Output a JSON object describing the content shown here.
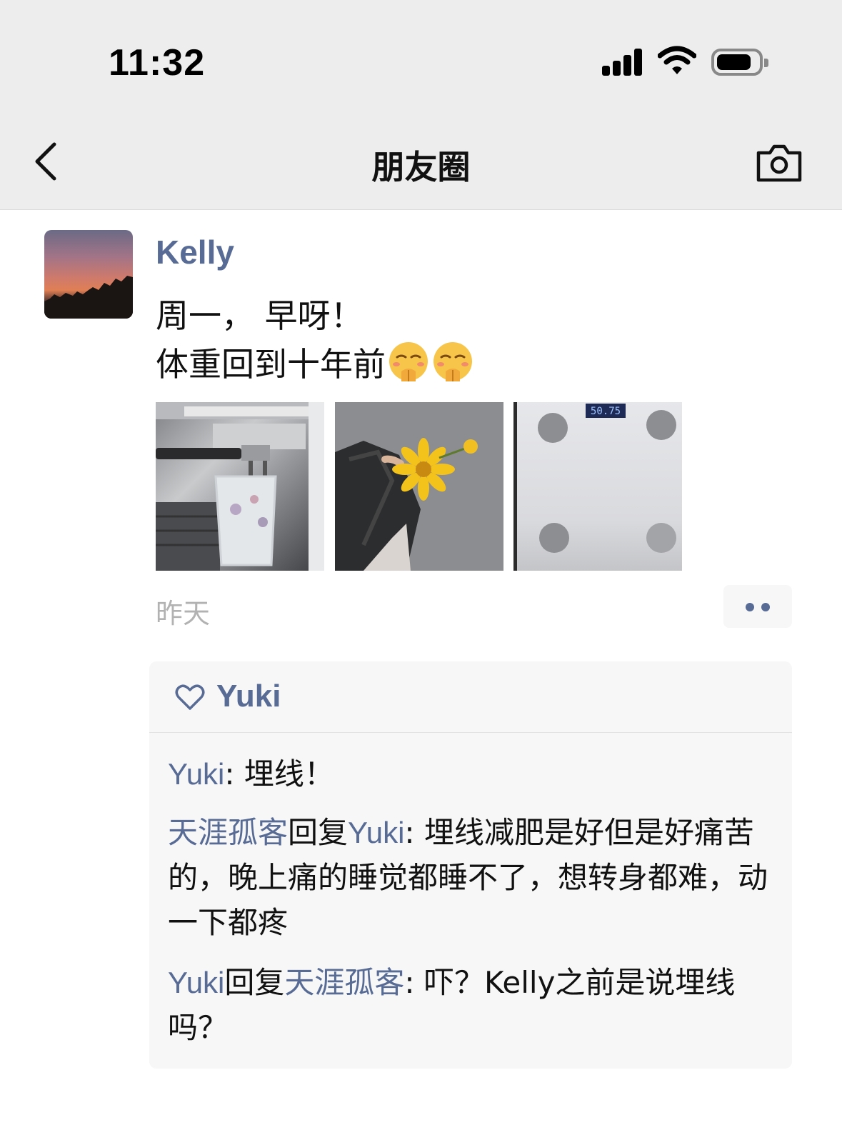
{
  "status_bar": {
    "time": "11:32",
    "icons": [
      "cellular-signal-icon",
      "wifi-icon",
      "battery-icon"
    ]
  },
  "nav": {
    "title": "朋友圈",
    "back_icon": "chevron-left-icon",
    "camera_icon": "camera-icon"
  },
  "post": {
    "author": "Kelly",
    "text_line1": "周一， 早呀！",
    "text_line2": "体重回到十年前",
    "emoji": [
      "shy-face-emoji",
      "shy-face-emoji"
    ],
    "photos": [
      "coffee-machine-photo",
      "yellow-flower-photo",
      "bathroom-scale-photo"
    ],
    "scale_reading": "50.75",
    "time": "昨天"
  },
  "likes": {
    "icon": "heart-icon",
    "names": "Yuki"
  },
  "comments": [
    {
      "name": "Yuki",
      "sep": ": ",
      "text": "埋线！"
    },
    {
      "name": "天涯孤客",
      "reply_word": "回复",
      "reply_to": "Yuki",
      "sep": ": ",
      "text": "埋线减肥是好但是好痛苦的，晚上痛的睡觉都睡不了，想转身都难，动一下都疼"
    },
    {
      "name": "Yuki",
      "reply_word": "回复",
      "reply_to": "天涯孤客",
      "sep": ": ",
      "text": "吓？Kelly之前是说埋线吗？"
    }
  ],
  "colors": {
    "name_link": "#576b95",
    "bar_bg": "#ededed",
    "comment_bg": "#f7f7f7",
    "time_gray": "#b2b2b2"
  }
}
